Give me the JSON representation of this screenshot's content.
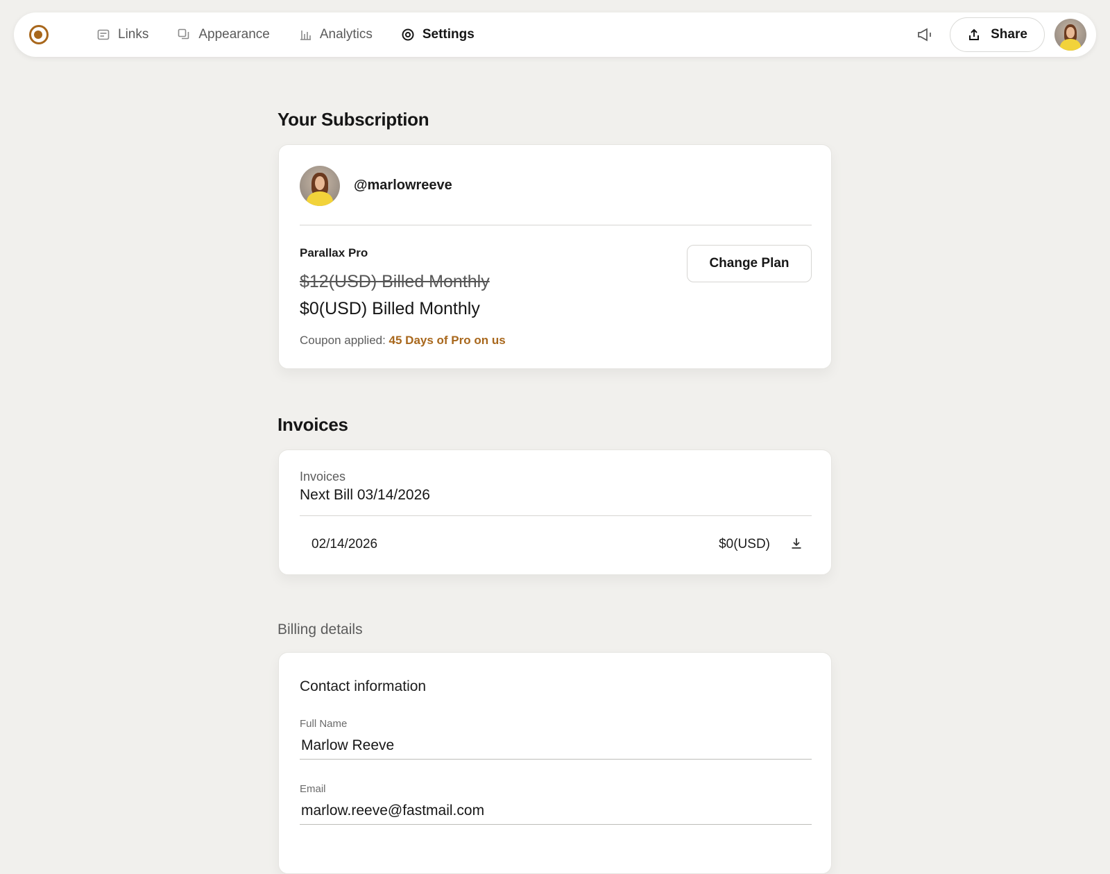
{
  "nav": {
    "items": [
      {
        "label": "Links",
        "icon": "links-icon"
      },
      {
        "label": "Appearance",
        "icon": "appearance-icon"
      },
      {
        "label": "Analytics",
        "icon": "analytics-icon"
      },
      {
        "label": "Settings",
        "icon": "settings-icon",
        "active": true
      }
    ],
    "share_label": "Share"
  },
  "subscription": {
    "title": "Your Subscription",
    "username": "@marlowreeve",
    "plan_name": "Parallax Pro",
    "old_price": "$12(USD) Billed Monthly",
    "new_price": "$0(USD) Billed Monthly",
    "coupon_prefix": "Coupon applied: ",
    "coupon_name": "45 Days of Pro on us",
    "change_plan_label": "Change Plan"
  },
  "invoices": {
    "title": "Invoices",
    "label": "Invoices",
    "next_bill": "Next Bill 03/14/2026",
    "rows": [
      {
        "date": "02/14/2026",
        "amount": "$0(USD)"
      }
    ]
  },
  "billing": {
    "label": "Billing details",
    "contact_title": "Contact information",
    "full_name_label": "Full Name",
    "full_name_value": "Marlow Reeve",
    "email_label": "Email",
    "email_value": "marlow.reeve@fastmail.com"
  },
  "colors": {
    "accent": "#a8671c",
    "background": "#f1f0ed"
  }
}
